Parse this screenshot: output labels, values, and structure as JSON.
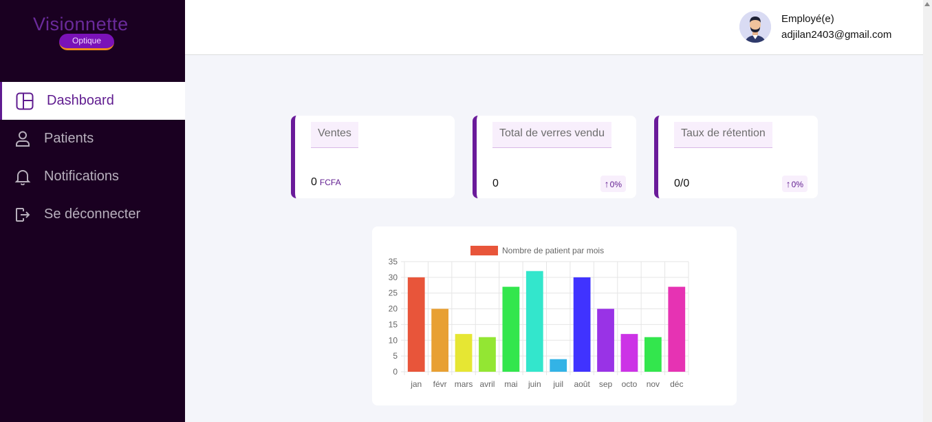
{
  "brand": {
    "logo_text": "Visionnette",
    "logo_sub": "Optique"
  },
  "sidebar": {
    "items": [
      {
        "label": "Dashboard",
        "icon": "dashboard-icon",
        "active": true
      },
      {
        "label": "Patients",
        "icon": "user-icon",
        "active": false
      },
      {
        "label": "Notifications",
        "icon": "bell-icon",
        "active": false
      },
      {
        "label": "Se déconnecter",
        "icon": "logout-icon",
        "active": false
      }
    ]
  },
  "header": {
    "user_role": "Employé(e)",
    "user_email": "adjilan2403@gmail.com",
    "avatar_icon": "user-avatar-icon"
  },
  "cards": [
    {
      "title": "Ventes",
      "value": "0",
      "unit": "FCFA",
      "badge": ""
    },
    {
      "title": "Total de verres vendu",
      "value": "0",
      "unit": "",
      "badge": "0%"
    },
    {
      "title": "Taux de rétention",
      "value": "0/0",
      "unit": "",
      "badge": "0%"
    }
  ],
  "colors": {
    "sidebar_bg": "#1a0021",
    "accent": "#6a1b9a",
    "page_bg": "#f4f5fa"
  },
  "chart_data": {
    "type": "bar",
    "legend": "Nombre de patient par mois",
    "legend_color": "#e8553a",
    "categories": [
      "jan",
      "févr",
      "mars",
      "avril",
      "mai",
      "juin",
      "juil",
      "août",
      "sep",
      "octo",
      "nov",
      "déc"
    ],
    "values": [
      30,
      20,
      12,
      11,
      27,
      32,
      4,
      30,
      20,
      12,
      11,
      27
    ],
    "colors": [
      "#e8553a",
      "#e8a033",
      "#e6e633",
      "#93e633",
      "#33e64d",
      "#33e6cc",
      "#33b3e6",
      "#4033ff",
      "#9933e6",
      "#cc33e6",
      "#33e64d",
      "#e633b3"
    ],
    "ylim": [
      0,
      35
    ],
    "yticks": [
      0,
      5,
      10,
      15,
      20,
      25,
      30,
      35
    ],
    "grid": true,
    "legend_position": "top"
  }
}
